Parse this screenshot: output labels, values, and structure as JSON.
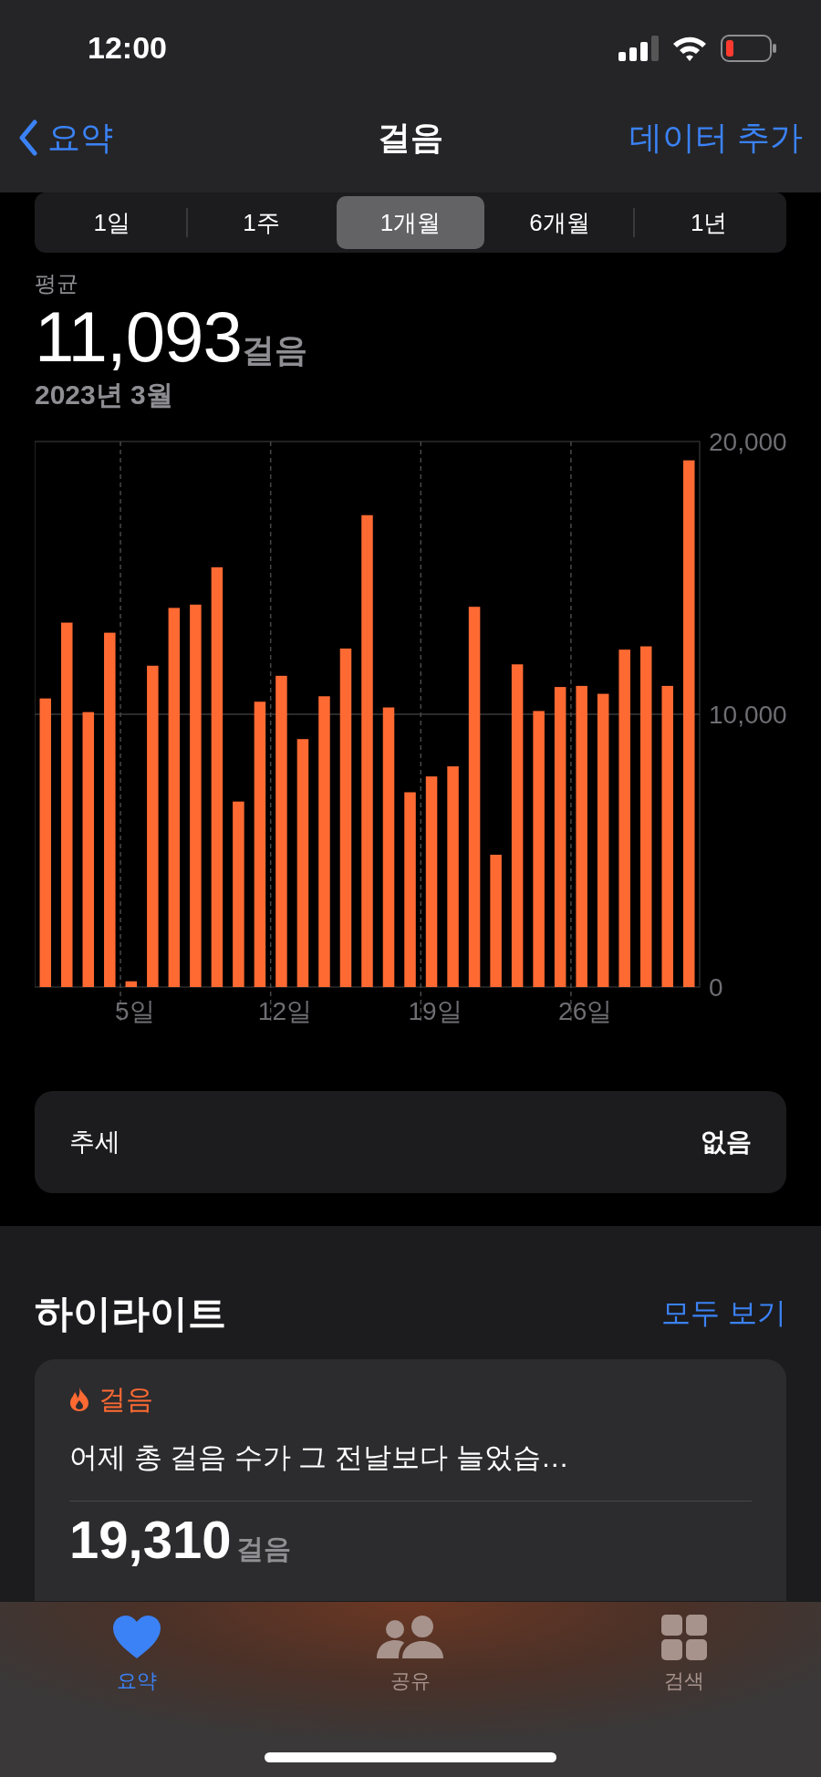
{
  "status_bar": {
    "time": "12:00"
  },
  "nav": {
    "back": "요약",
    "title": "걸음",
    "action": "데이터 추가"
  },
  "segments": [
    {
      "label": "1일",
      "selected": false
    },
    {
      "label": "1주",
      "selected": false
    },
    {
      "label": "1개월",
      "selected": true
    },
    {
      "label": "6개월",
      "selected": false
    },
    {
      "label": "1년",
      "selected": false
    }
  ],
  "summary": {
    "label": "평균",
    "value": "11,093",
    "unit": "걸음",
    "period": "2023년 3월"
  },
  "chart": {
    "chart_data": {
      "type": "bar",
      "x": [
        1,
        2,
        3,
        4,
        5,
        6,
        7,
        8,
        9,
        10,
        11,
        12,
        13,
        14,
        15,
        16,
        17,
        18,
        19,
        20,
        21,
        22,
        23,
        24,
        25,
        26,
        27,
        28,
        29,
        30,
        31
      ],
      "series": [
        {
          "color": "#ff6a33",
          "values": [
            10580,
            13360,
            10080,
            12990,
            210,
            11780,
            13900,
            14020,
            15390,
            6800,
            10460,
            11410,
            9090,
            10660,
            12410,
            17300,
            10250,
            7140,
            7720,
            8090,
            13940,
            4850,
            11830,
            10120,
            11000,
            11040,
            10750,
            12370,
            12490,
            11040,
            19310
          ]
        }
      ],
      "xlim": [
        0.5,
        31.5
      ],
      "ylim": [
        0,
        20000
      ],
      "yticks": [
        {
          "value": 0,
          "label": "0"
        },
        {
          "value": 10000,
          "label": "10,000"
        },
        {
          "value": 20000,
          "label": "20,000"
        }
      ],
      "xticks": [
        {
          "value": 5,
          "label": "5일"
        },
        {
          "value": 12,
          "label": "12일"
        },
        {
          "value": 19,
          "label": "19일"
        },
        {
          "value": 26,
          "label": "26일"
        }
      ]
    }
  },
  "trend": {
    "label": "추세",
    "value": "없음"
  },
  "highlights": {
    "title": "하이라이트",
    "link": "모두 보기",
    "card": {
      "category": "걸음",
      "text": "어제 총 걸음 수가 그 전날보다 늘었습…",
      "value": "19,310",
      "unit": "걸음"
    }
  },
  "tab_bar": [
    {
      "label": "요약",
      "selected": true
    },
    {
      "label": "공유",
      "selected": false
    },
    {
      "label": "검색",
      "selected": false
    }
  ]
}
